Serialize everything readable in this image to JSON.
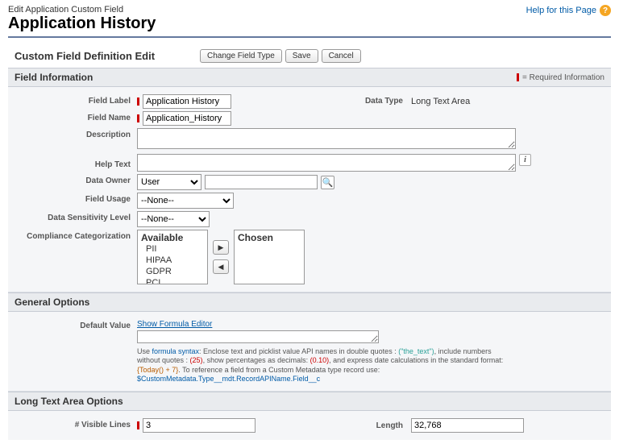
{
  "header": {
    "breadcrumb": "Edit Application Custom Field",
    "title": "Application History",
    "help_label": "Help for this Page"
  },
  "toolbar": {
    "section_title": "Custom Field Definition Edit",
    "buttons": {
      "change_type": "Change Field Type",
      "save": "Save",
      "cancel": "Cancel"
    }
  },
  "field_info": {
    "section_label": "Field Information",
    "required_note": "= Required Information",
    "labels": {
      "field_label": "Field Label",
      "field_name": "Field Name",
      "description": "Description",
      "help_text": "Help Text",
      "data_owner": "Data Owner",
      "field_usage": "Field Usage",
      "data_sensitivity": "Data Sensitivity Level",
      "compliance": "Compliance Categorization",
      "data_type": "Data Type"
    },
    "values": {
      "field_label": "Application History",
      "field_name": "Application_History",
      "description": "",
      "help_text": "",
      "data_owner_select": "User",
      "data_owner_lookup": "",
      "field_usage": "--None--",
      "data_sensitivity": "--None--",
      "data_type": "Long Text Area"
    },
    "duelling": {
      "available_label": "Available",
      "chosen_label": "Chosen",
      "available": [
        "PII",
        "HIPAA",
        "GDPR",
        "PCI"
      ],
      "chosen": []
    }
  },
  "general": {
    "section_label": "General Options",
    "labels": {
      "default_value": "Default Value"
    },
    "formula_link": "Show Formula Editor",
    "default_value": "",
    "helper": {
      "pre1": "Use ",
      "link1": "formula syntax",
      "post1": ": Enclose text and picklist value API names in double quotes : ",
      "q1": "(\"the_text\")",
      "post2": ", include numbers without quotes : ",
      "q2": "(25)",
      "post3": ", show percentages as decimals: ",
      "q3": "(0.10)",
      "post4": ", and express date calculations in the standard format: ",
      "q4": "{Today() + 7}",
      "post5": ". To reference a field from a Custom Metadata type record use: ",
      "ref": "$CustomMetadata.Type__mdt.RecordAPIName.Field__c"
    }
  },
  "long_text": {
    "section_label": "Long Text Area Options",
    "labels": {
      "visible_lines": "# Visible Lines",
      "length": "Length"
    },
    "values": {
      "visible_lines": "3",
      "length": "32,768"
    }
  }
}
